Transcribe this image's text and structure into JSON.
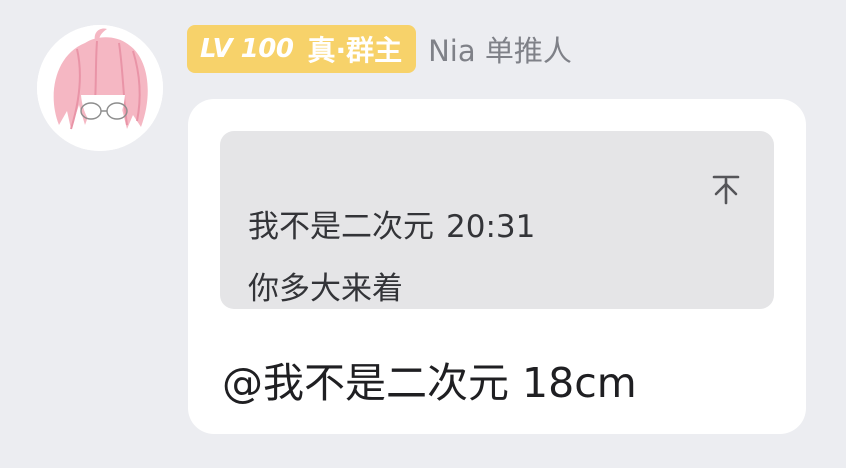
{
  "sender": {
    "level": "LV 100",
    "role": "真·群主",
    "name": "Nia 单推人",
    "avatar_icon": "pink-hair-anime-girl-avatar"
  },
  "quote": {
    "author": "我不是二次元",
    "time": "20:31",
    "text": "你多大来着",
    "jump_icon": "arrow-up-to-top-icon"
  },
  "message": {
    "text": "@我不是二次元 18cm"
  },
  "colors": {
    "background": "#ecedf1",
    "badge": "#f7d26a",
    "bubble": "#ffffff",
    "quote_bg": "#e5e5e7",
    "name_gray": "#7f8188"
  }
}
